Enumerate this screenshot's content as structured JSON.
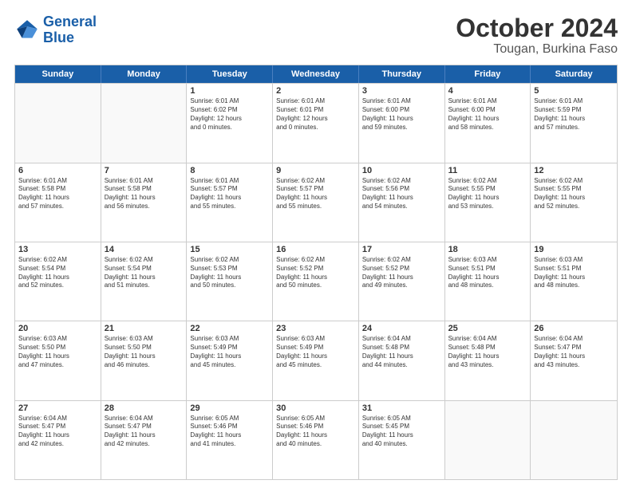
{
  "logo": {
    "line1": "General",
    "line2": "Blue"
  },
  "title": "October 2024",
  "subtitle": "Tougan, Burkina Faso",
  "days": [
    "Sunday",
    "Monday",
    "Tuesday",
    "Wednesday",
    "Thursday",
    "Friday",
    "Saturday"
  ],
  "weeks": [
    [
      {
        "day": "",
        "lines": []
      },
      {
        "day": "",
        "lines": []
      },
      {
        "day": "1",
        "lines": [
          "Sunrise: 6:01 AM",
          "Sunset: 6:02 PM",
          "Daylight: 12 hours",
          "and 0 minutes."
        ]
      },
      {
        "day": "2",
        "lines": [
          "Sunrise: 6:01 AM",
          "Sunset: 6:01 PM",
          "Daylight: 12 hours",
          "and 0 minutes."
        ]
      },
      {
        "day": "3",
        "lines": [
          "Sunrise: 6:01 AM",
          "Sunset: 6:00 PM",
          "Daylight: 11 hours",
          "and 59 minutes."
        ]
      },
      {
        "day": "4",
        "lines": [
          "Sunrise: 6:01 AM",
          "Sunset: 6:00 PM",
          "Daylight: 11 hours",
          "and 58 minutes."
        ]
      },
      {
        "day": "5",
        "lines": [
          "Sunrise: 6:01 AM",
          "Sunset: 5:59 PM",
          "Daylight: 11 hours",
          "and 57 minutes."
        ]
      }
    ],
    [
      {
        "day": "6",
        "lines": [
          "Sunrise: 6:01 AM",
          "Sunset: 5:58 PM",
          "Daylight: 11 hours",
          "and 57 minutes."
        ]
      },
      {
        "day": "7",
        "lines": [
          "Sunrise: 6:01 AM",
          "Sunset: 5:58 PM",
          "Daylight: 11 hours",
          "and 56 minutes."
        ]
      },
      {
        "day": "8",
        "lines": [
          "Sunrise: 6:01 AM",
          "Sunset: 5:57 PM",
          "Daylight: 11 hours",
          "and 55 minutes."
        ]
      },
      {
        "day": "9",
        "lines": [
          "Sunrise: 6:02 AM",
          "Sunset: 5:57 PM",
          "Daylight: 11 hours",
          "and 55 minutes."
        ]
      },
      {
        "day": "10",
        "lines": [
          "Sunrise: 6:02 AM",
          "Sunset: 5:56 PM",
          "Daylight: 11 hours",
          "and 54 minutes."
        ]
      },
      {
        "day": "11",
        "lines": [
          "Sunrise: 6:02 AM",
          "Sunset: 5:55 PM",
          "Daylight: 11 hours",
          "and 53 minutes."
        ]
      },
      {
        "day": "12",
        "lines": [
          "Sunrise: 6:02 AM",
          "Sunset: 5:55 PM",
          "Daylight: 11 hours",
          "and 52 minutes."
        ]
      }
    ],
    [
      {
        "day": "13",
        "lines": [
          "Sunrise: 6:02 AM",
          "Sunset: 5:54 PM",
          "Daylight: 11 hours",
          "and 52 minutes."
        ]
      },
      {
        "day": "14",
        "lines": [
          "Sunrise: 6:02 AM",
          "Sunset: 5:54 PM",
          "Daylight: 11 hours",
          "and 51 minutes."
        ]
      },
      {
        "day": "15",
        "lines": [
          "Sunrise: 6:02 AM",
          "Sunset: 5:53 PM",
          "Daylight: 11 hours",
          "and 50 minutes."
        ]
      },
      {
        "day": "16",
        "lines": [
          "Sunrise: 6:02 AM",
          "Sunset: 5:52 PM",
          "Daylight: 11 hours",
          "and 50 minutes."
        ]
      },
      {
        "day": "17",
        "lines": [
          "Sunrise: 6:02 AM",
          "Sunset: 5:52 PM",
          "Daylight: 11 hours",
          "and 49 minutes."
        ]
      },
      {
        "day": "18",
        "lines": [
          "Sunrise: 6:03 AM",
          "Sunset: 5:51 PM",
          "Daylight: 11 hours",
          "and 48 minutes."
        ]
      },
      {
        "day": "19",
        "lines": [
          "Sunrise: 6:03 AM",
          "Sunset: 5:51 PM",
          "Daylight: 11 hours",
          "and 48 minutes."
        ]
      }
    ],
    [
      {
        "day": "20",
        "lines": [
          "Sunrise: 6:03 AM",
          "Sunset: 5:50 PM",
          "Daylight: 11 hours",
          "and 47 minutes."
        ]
      },
      {
        "day": "21",
        "lines": [
          "Sunrise: 6:03 AM",
          "Sunset: 5:50 PM",
          "Daylight: 11 hours",
          "and 46 minutes."
        ]
      },
      {
        "day": "22",
        "lines": [
          "Sunrise: 6:03 AM",
          "Sunset: 5:49 PM",
          "Daylight: 11 hours",
          "and 45 minutes."
        ]
      },
      {
        "day": "23",
        "lines": [
          "Sunrise: 6:03 AM",
          "Sunset: 5:49 PM",
          "Daylight: 11 hours",
          "and 45 minutes."
        ]
      },
      {
        "day": "24",
        "lines": [
          "Sunrise: 6:04 AM",
          "Sunset: 5:48 PM",
          "Daylight: 11 hours",
          "and 44 minutes."
        ]
      },
      {
        "day": "25",
        "lines": [
          "Sunrise: 6:04 AM",
          "Sunset: 5:48 PM",
          "Daylight: 11 hours",
          "and 43 minutes."
        ]
      },
      {
        "day": "26",
        "lines": [
          "Sunrise: 6:04 AM",
          "Sunset: 5:47 PM",
          "Daylight: 11 hours",
          "and 43 minutes."
        ]
      }
    ],
    [
      {
        "day": "27",
        "lines": [
          "Sunrise: 6:04 AM",
          "Sunset: 5:47 PM",
          "Daylight: 11 hours",
          "and 42 minutes."
        ]
      },
      {
        "day": "28",
        "lines": [
          "Sunrise: 6:04 AM",
          "Sunset: 5:47 PM",
          "Daylight: 11 hours",
          "and 42 minutes."
        ]
      },
      {
        "day": "29",
        "lines": [
          "Sunrise: 6:05 AM",
          "Sunset: 5:46 PM",
          "Daylight: 11 hours",
          "and 41 minutes."
        ]
      },
      {
        "day": "30",
        "lines": [
          "Sunrise: 6:05 AM",
          "Sunset: 5:46 PM",
          "Daylight: 11 hours",
          "and 40 minutes."
        ]
      },
      {
        "day": "31",
        "lines": [
          "Sunrise: 6:05 AM",
          "Sunset: 5:45 PM",
          "Daylight: 11 hours",
          "and 40 minutes."
        ]
      },
      {
        "day": "",
        "lines": []
      },
      {
        "day": "",
        "lines": []
      }
    ]
  ]
}
